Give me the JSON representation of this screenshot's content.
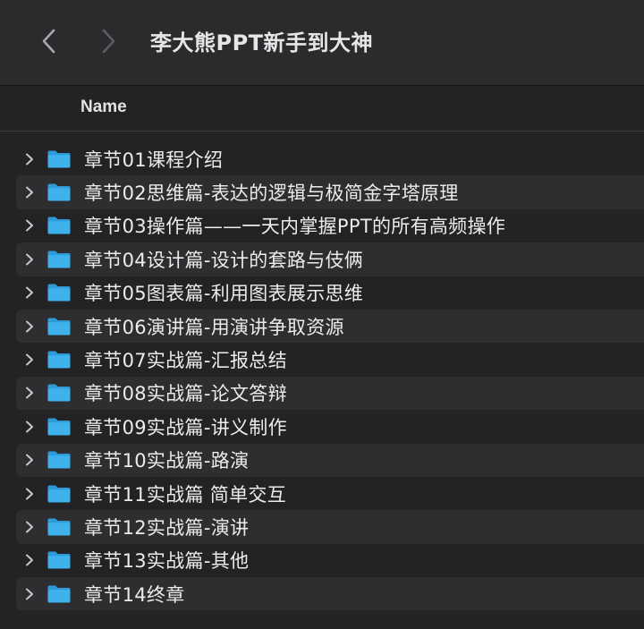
{
  "window": {
    "title": "李大熊PPT新手到大神"
  },
  "toolbar": {
    "back_icon": "chevron-left-icon",
    "forward_icon": "chevron-right-icon"
  },
  "columns": {
    "name": "Name"
  },
  "items": [
    {
      "label": "章节01课程介绍"
    },
    {
      "label": "章节02思维篇-表达的逻辑与极简金字塔原理"
    },
    {
      "label": "章节03操作篇——一天内掌握PPT的所有高频操作"
    },
    {
      "label": "章节04设计篇-设计的套路与伎俩"
    },
    {
      "label": "章节05图表篇-利用图表展示思维"
    },
    {
      "label": "章节06演讲篇-用演讲争取资源"
    },
    {
      "label": "章节07实战篇-汇报总结"
    },
    {
      "label": "章节08实战篇-论文答辩"
    },
    {
      "label": "章节09实战篇-讲义制作"
    },
    {
      "label": "章节10实战篇-路演"
    },
    {
      "label": "章节11实战篇 简单交互"
    },
    {
      "label": "章节12实战篇-演讲"
    },
    {
      "label": "章节13实战篇-其他"
    },
    {
      "label": "章节14终章"
    }
  ],
  "colors": {
    "folder": "#3fb2ec",
    "folder_tab": "#2f9ad6",
    "background": "#232325",
    "row_alt": "#2e2e31"
  }
}
